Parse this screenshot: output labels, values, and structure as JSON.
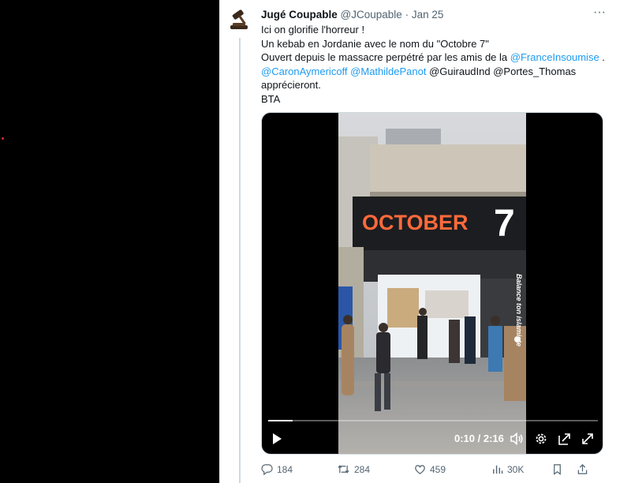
{
  "tweet": {
    "author": "Jugé Coupable",
    "handle": "@JCoupable",
    "separator": "·",
    "date": "Jan 25",
    "more": "···",
    "line1": "Ici on glorifie l'horreur !",
    "line2": "Un kebab en Jordanie avec le nom du \"Octobre 7\"",
    "line3_text": "Ouvert depuis le massacre perpétré par les amis de la ",
    "line3_mention": "@FranceInsoumise",
    "line3_end": " .",
    "mention_caron": "@CaronAymericoff",
    "mention_panot": "@MathildePanot",
    "line4_rest": " @GuiraudInd @Portes_Thomas",
    "line5": "apprécieront.",
    "line6": "BTA"
  },
  "video": {
    "sign_word": "OCTOBER",
    "sign_number": "7",
    "watermark": "Balance ton islamiste",
    "time_display": "0:10 / 2:16",
    "progress_fraction": 0.074
  },
  "actions": {
    "replies": "184",
    "reposts": "284",
    "likes": "459",
    "views": "30K"
  },
  "colors": {
    "accent": "#1d9bf0",
    "muted": "#536471",
    "text": "#0f1419"
  }
}
